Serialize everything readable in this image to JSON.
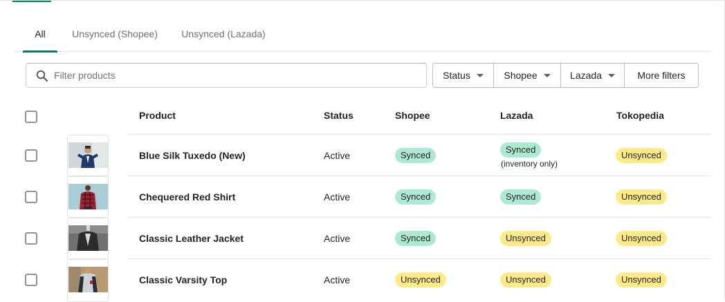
{
  "colors": {
    "accent": "#008060",
    "synced": "#aee9d1",
    "unsynced": "#ffea8a"
  },
  "tabs": [
    "All",
    "Unsynced (Shopee)",
    "Unsynced (Lazada)"
  ],
  "search": {
    "placeholder": "Filter products",
    "icon": "search-icon"
  },
  "filters": [
    "Status",
    "Shopee",
    "Lazada",
    "More filters"
  ],
  "table": {
    "headers": {
      "product": "Product",
      "status": "Status",
      "shopee": "Shopee",
      "lazada": "Lazada",
      "tokopedia": "Tokopedia"
    },
    "rows": [
      {
        "name": "Blue Silk Tuxedo (New)",
        "status": "Active",
        "shopee": "Synced",
        "lazada": "Synced",
        "lazada_note": "(inventory only)",
        "tokopedia": "Unsynced"
      },
      {
        "name": "Chequered Red Shirt",
        "status": "Active",
        "shopee": "Synced",
        "lazada": "Synced",
        "tokopedia": "Unsynced"
      },
      {
        "name": "Classic Leather Jacket",
        "status": "Active",
        "shopee": "Synced",
        "lazada": "Unsynced",
        "tokopedia": "Unsynced"
      },
      {
        "name": "Classic Varsity Top",
        "status": "Active",
        "shopee": "Unsynced",
        "lazada": "Unsynced",
        "tokopedia": "Unsynced"
      }
    ]
  }
}
